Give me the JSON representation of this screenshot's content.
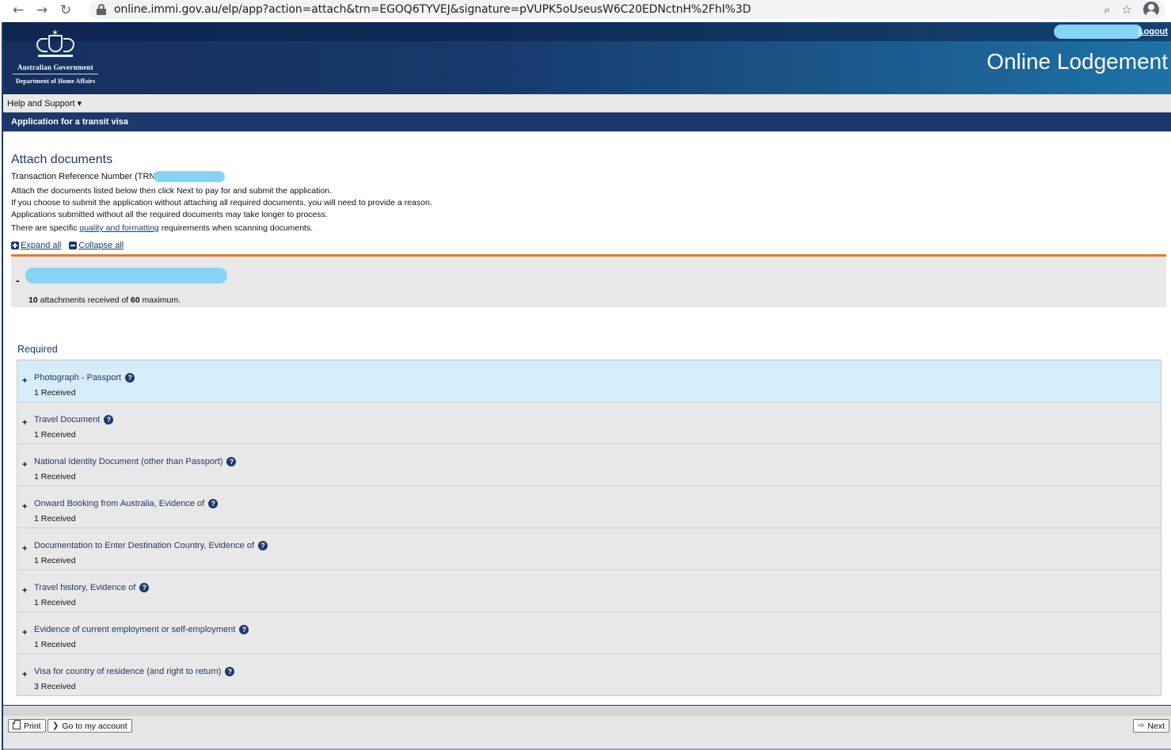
{
  "browser": {
    "url": "online.immi.gov.au/elp/app?action=attach&trn=EGOQ6TYVEJ&signature=pVUPK5oUseusW6C20EDNctnH%2FhI%3D"
  },
  "header": {
    "gov_name": "Australian Government",
    "dept_name": "Department of Home Affairs",
    "logout": "Logout",
    "app_title": "Online Lodgement"
  },
  "menu": {
    "help": "Help and Support ▾"
  },
  "section": {
    "title": "Application for a transit visa"
  },
  "page": {
    "heading": "Attach documents",
    "trn_label": "Transaction Reference Number (TRN)",
    "intro_1": "Attach the documents listed below then click Next to pay for and submit the application.",
    "intro_2": "If you choose to submit the application without attaching all required documents, you will need to provide a reason.",
    "intro_3": "Applications submitted without all the required documents may take longer to process.",
    "intro_4_pre": "There are specific ",
    "intro_4_link": "quality and formatting",
    "intro_4_post": " requirements when scanning documents.",
    "expand_all": "Expand all",
    "collapse_all": "Collapse all"
  },
  "applicant": {
    "toggle": "-",
    "received": "10",
    "attach_mid": " attachments received of ",
    "maximum": "60",
    "attach_end": " maximum."
  },
  "required_label": "Required",
  "documents": [
    {
      "title": "Photograph - Passport",
      "received": "1 Received"
    },
    {
      "title": "Travel Document",
      "received": "1 Received"
    },
    {
      "title": "National Identity Document (other than Passport)",
      "received": "1 Received"
    },
    {
      "title": "Onward Booking from Australia, Evidence of",
      "received": "1 Received"
    },
    {
      "title": "Documentation to Enter Destination Country, Evidence of",
      "received": "1 Received"
    },
    {
      "title": "Travel history, Evidence of",
      "received": "1 Received"
    },
    {
      "title": "Evidence of current employment or self-employment",
      "received": "1 Received"
    },
    {
      "title": "Visa for country of residence (and right to return)",
      "received": "3 Received"
    }
  ],
  "footer": {
    "print": "Print",
    "go_account": "Go to my account",
    "next": "Next"
  },
  "colors": {
    "navy": "#1b3a6b",
    "accent_orange": "#e07b2c",
    "highlight_row": "#d6ecf8"
  }
}
